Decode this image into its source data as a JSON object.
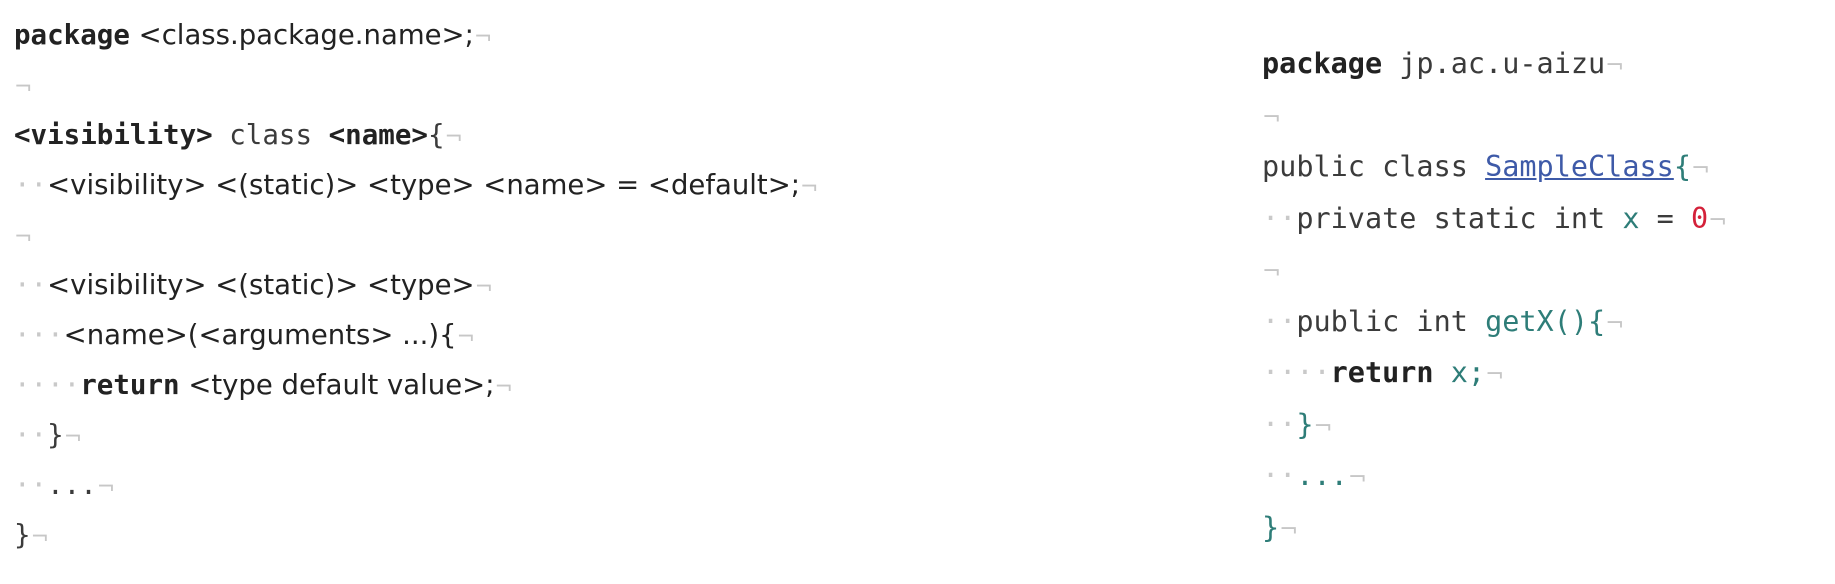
{
  "template": {
    "lines": [
      [
        {
          "t": "package",
          "c": "kw"
        },
        {
          "t": " <class.package.name>;",
          "c": "ph"
        },
        {
          "t": "¬",
          "c": "eol"
        }
      ],
      [
        {
          "t": "¬",
          "c": "eol"
        }
      ],
      [
        {
          "t": "<visibility>",
          "c": "kw"
        },
        {
          "t": " class ",
          "c": "plain"
        },
        {
          "t": "<name>",
          "c": "kw"
        },
        {
          "t": "{",
          "c": "plain"
        },
        {
          "t": "¬",
          "c": "eol"
        }
      ],
      [
        {
          "t": "··",
          "c": "ind"
        },
        {
          "t": "<visibility> <(static)> <type> <name> = <default>;",
          "c": "ph"
        },
        {
          "t": "¬",
          "c": "eol"
        }
      ],
      [
        {
          "t": "¬",
          "c": "eol"
        }
      ],
      [
        {
          "t": "··",
          "c": "ind"
        },
        {
          "t": "<visibility> <(static)> <type>",
          "c": "ph"
        },
        {
          "t": "¬",
          "c": "eol"
        }
      ],
      [
        {
          "t": "···",
          "c": "ind"
        },
        {
          "t": "<name>(<arguments> ...){",
          "c": "ph"
        },
        {
          "t": "¬",
          "c": "eol"
        }
      ],
      [
        {
          "t": "····",
          "c": "ind"
        },
        {
          "t": "return",
          "c": "kw"
        },
        {
          "t": " <type default value>;",
          "c": "ph"
        },
        {
          "t": "¬",
          "c": "eol"
        }
      ],
      [
        {
          "t": "··",
          "c": "ind"
        },
        {
          "t": "}",
          "c": "plain"
        },
        {
          "t": "¬",
          "c": "eol"
        }
      ],
      [
        {
          "t": "··",
          "c": "ind"
        },
        {
          "t": "...",
          "c": "plain"
        },
        {
          "t": "¬",
          "c": "eol"
        }
      ],
      [
        {
          "t": "}",
          "c": "plain"
        },
        {
          "t": "¬",
          "c": "eol"
        }
      ]
    ]
  },
  "example": {
    "lines": [
      [
        {
          "t": "package",
          "c": "kw"
        },
        {
          "t": " jp.ac.u-aizu",
          "c": "plain"
        },
        {
          "t": "¬",
          "c": "eol"
        }
      ],
      [
        {
          "t": "¬",
          "c": "eol"
        }
      ],
      [
        {
          "t": "public class ",
          "c": "plain"
        },
        {
          "t": "SampleClass",
          "c": "link"
        },
        {
          "t": "{",
          "c": "ident"
        },
        {
          "t": "¬",
          "c": "eol"
        }
      ],
      [
        {
          "t": "··",
          "c": "ind"
        },
        {
          "t": "private static int ",
          "c": "plain"
        },
        {
          "t": "x",
          "c": "ident"
        },
        {
          "t": " = ",
          "c": "plain"
        },
        {
          "t": "0",
          "c": "num"
        },
        {
          "t": "¬",
          "c": "eol"
        }
      ],
      [
        {
          "t": "¬",
          "c": "eol"
        }
      ],
      [
        {
          "t": "··",
          "c": "ind"
        },
        {
          "t": "public int ",
          "c": "plain"
        },
        {
          "t": "getX(){",
          "c": "ident"
        },
        {
          "t": "¬",
          "c": "eol"
        }
      ],
      [
        {
          "t": "····",
          "c": "ind"
        },
        {
          "t": "return",
          "c": "kw"
        },
        {
          "t": " x;",
          "c": "ident"
        },
        {
          "t": "¬",
          "c": "eol"
        }
      ],
      [
        {
          "t": "··",
          "c": "ind"
        },
        {
          "t": "}",
          "c": "ident"
        },
        {
          "t": "¬",
          "c": "eol"
        }
      ],
      [
        {
          "t": "··",
          "c": "ind"
        },
        {
          "t": "...",
          "c": "ident"
        },
        {
          "t": "¬",
          "c": "eol"
        }
      ],
      [
        {
          "t": "}",
          "c": "ident"
        },
        {
          "t": "¬",
          "c": "eol"
        }
      ]
    ]
  }
}
